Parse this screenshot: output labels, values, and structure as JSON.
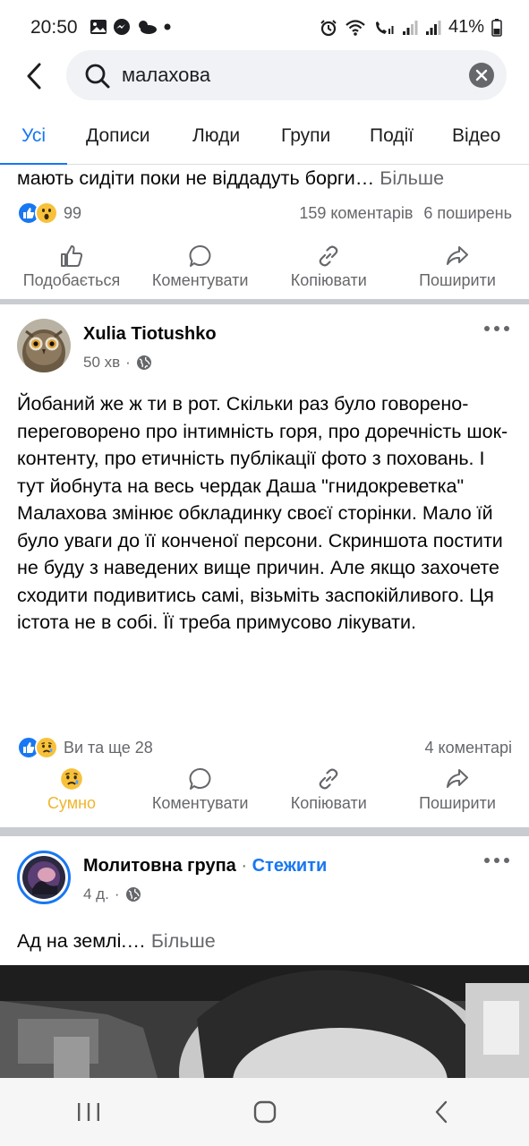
{
  "status_bar": {
    "time": "20:50",
    "battery": "41%",
    "left_icons": [
      "gallery-icon",
      "messenger-icon",
      "weather-icon",
      "dot-icon"
    ],
    "right_icons": [
      "alarm-icon",
      "wifi-icon",
      "call-signal-icon",
      "signal-icon",
      "signal-icon-2",
      "battery-icon"
    ]
  },
  "search": {
    "query": "малахова",
    "back_icon": "back-arrow-icon",
    "search_icon": "search-icon",
    "clear_icon": "clear-icon"
  },
  "tabs": [
    {
      "label": "Усі",
      "active": true
    },
    {
      "label": "Дописи",
      "active": false
    },
    {
      "label": "Люди",
      "active": false
    },
    {
      "label": "Групи",
      "active": false
    },
    {
      "label": "Події",
      "active": false
    },
    {
      "label": "Відео",
      "active": false
    }
  ],
  "post1": {
    "text_tail": "мають сидіти поки не віддадуть борги…",
    "more": "Більше",
    "reactions_count": "99",
    "comments": "159 коментарів",
    "shares": "6 поширень",
    "reaction_icons": [
      "like-icon",
      "wow-icon"
    ],
    "actions": [
      {
        "label": "Подобається",
        "icon": "like-outline-icon"
      },
      {
        "label": "Коментувати",
        "icon": "comment-icon"
      },
      {
        "label": "Копіювати",
        "icon": "link-icon"
      },
      {
        "label": "Поширити",
        "icon": "share-icon"
      }
    ]
  },
  "post2": {
    "author": "Xulia Tiotushko",
    "time": "50 хв",
    "visibility_icon": "globe-icon",
    "text": "Йобаний же ж ти в рот. Скільки раз було говорено-переговорено про інтимність горя, про доречність шок-контенту, про етичність публікації фото з поховань. І тут йобнута на весь чердак Даша \"гнидокреветка\" Малахова змінює обкладинку своєї сторінки. Мало їй було уваги до її конченої персони. Скриншота постити не буду з наведених вище причин. Але якщо захочете сходити подивитись самі, візьміть заспокійливого. Ця істота не в собі. Її треба примусово лікувати.",
    "reactions_text": "Ви та ще 28",
    "comments": "4 коментарі",
    "reaction_icons": [
      "like-icon",
      "sad-icon"
    ],
    "actions": [
      {
        "label": "Сумно",
        "icon": "sad-reaction-icon",
        "active": true
      },
      {
        "label": "Коментувати",
        "icon": "comment-icon"
      },
      {
        "label": "Копіювати",
        "icon": "link-icon"
      },
      {
        "label": "Поширити",
        "icon": "share-icon"
      }
    ]
  },
  "post3": {
    "author": "Молитовна група",
    "separator": "·",
    "follow": "Стежити",
    "time": "4 д.",
    "visibility_icon": "globe-icon",
    "text": "Ад на землі.…",
    "more": "Більше"
  },
  "nav": [
    "recent-apps-icon",
    "home-icon",
    "back-icon"
  ],
  "colors": {
    "accent": "#1877f2",
    "secondary_text": "#65676b",
    "sad": "#f0b52e",
    "divider": "#c9ccd1"
  }
}
